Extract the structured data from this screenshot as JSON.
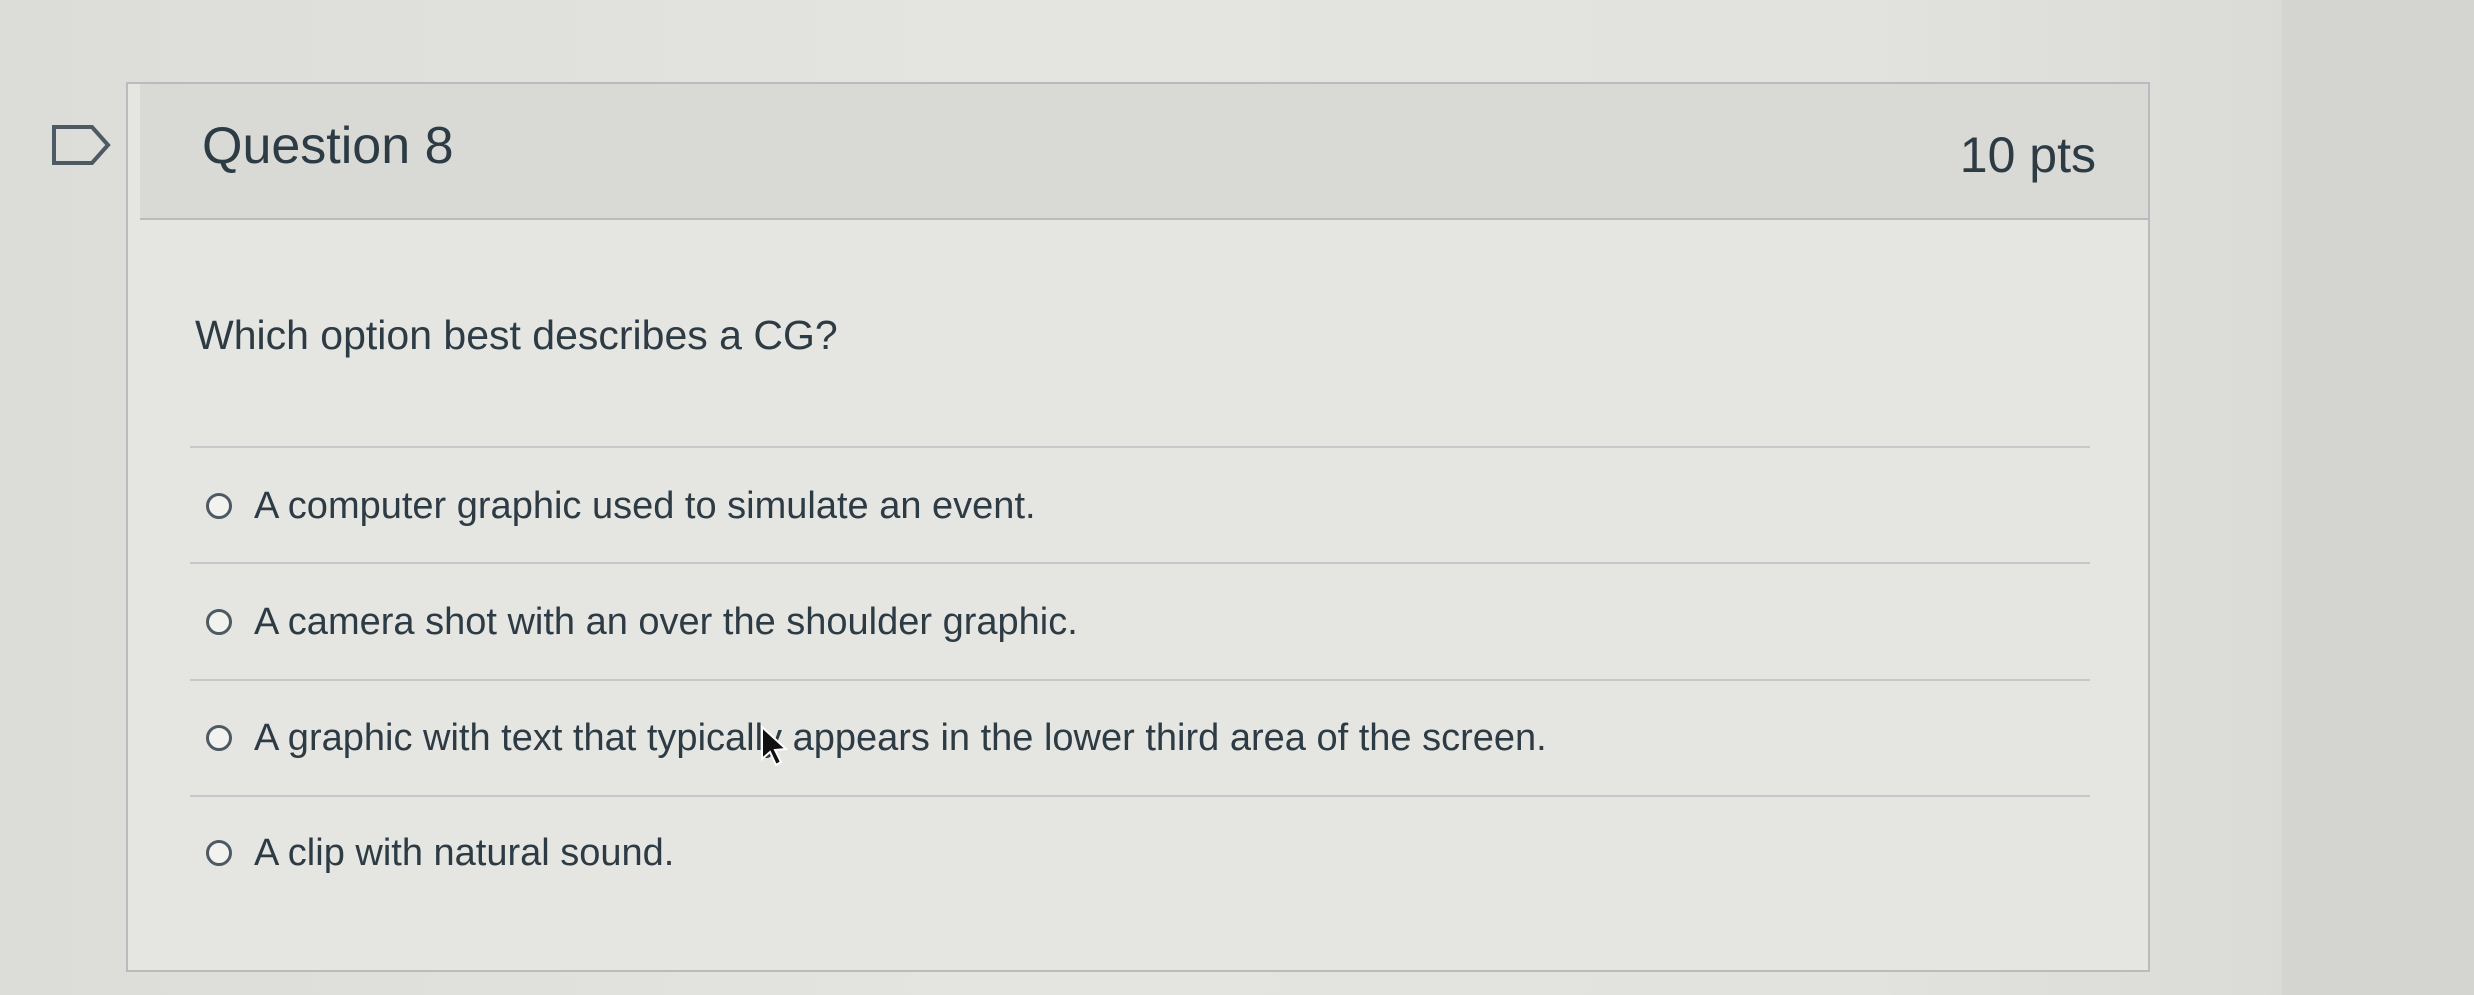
{
  "question": {
    "title": "Question 8",
    "points": "10 pts",
    "prompt": "Which option best describes a CG?",
    "flag_icon": "flag-icon"
  },
  "answers": [
    {
      "label": "A computer graphic used to simulate an event.",
      "selected": false
    },
    {
      "label": "A camera shot with an over the shoulder graphic.",
      "selected": false
    },
    {
      "label": "A graphic with text that typically appears in the lower third area of the screen.",
      "selected": false
    },
    {
      "label": "A clip with natural sound.",
      "selected": false
    }
  ],
  "colors": {
    "text": "#2d3b45",
    "border": "#b8bcbf",
    "header_bg": "#d9d9d5"
  }
}
